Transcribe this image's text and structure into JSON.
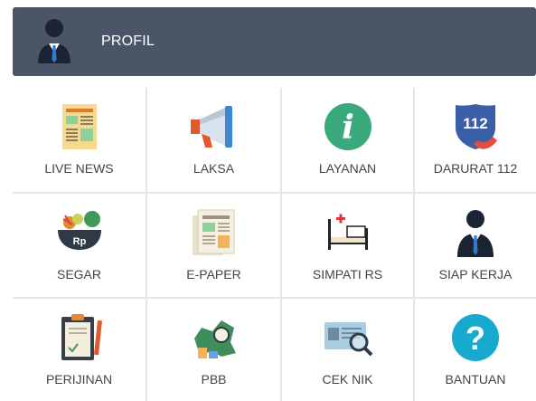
{
  "header": {
    "title": "PROFIL",
    "icon": "user-avatar-icon"
  },
  "tiles": [
    {
      "label": "LIVE NEWS",
      "icon": "newspaper-icon"
    },
    {
      "label": "LAKSA",
      "icon": "megaphone-icon"
    },
    {
      "label": "LAYANAN",
      "icon": "info-icon"
    },
    {
      "label": "DARURAT 112",
      "icon": "emergency-112-icon"
    },
    {
      "label": "SEGAR",
      "icon": "vegetable-basket-icon"
    },
    {
      "label": "E-PAPER",
      "icon": "e-paper-icon"
    },
    {
      "label": "SIMPATI RS",
      "icon": "hospital-bed-icon"
    },
    {
      "label": "SIAP KERJA",
      "icon": "job-seeker-icon"
    },
    {
      "label": "PERIJINAN",
      "icon": "clipboard-license-icon"
    },
    {
      "label": "PBB",
      "icon": "tax-map-icon"
    },
    {
      "label": "CEK NIK",
      "icon": "id-card-search-icon"
    },
    {
      "label": "BANTUAN",
      "icon": "help-icon"
    }
  ],
  "icon_numbers": {
    "darurat": "112"
  },
  "icon_glyphs": {
    "info": "i",
    "help": "?",
    "currency": "Rp"
  },
  "colors": {
    "header_bg": "#4a5568",
    "info_green": "#3aaa7d",
    "help_cyan": "#18a9cf",
    "emergency_blue": "#3b5ea8",
    "emergency_red": "#e34b3c"
  }
}
